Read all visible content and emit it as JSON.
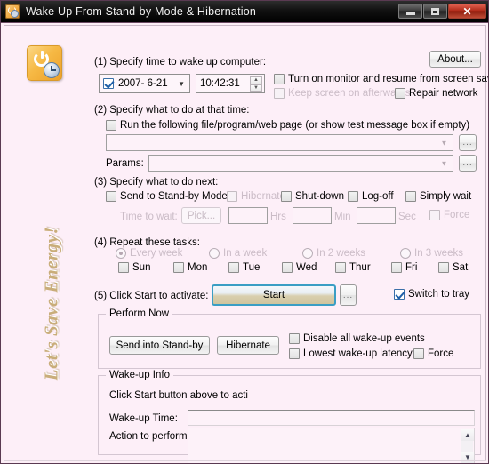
{
  "window": {
    "title": "Wake Up From Stand-by Mode & Hibernation",
    "icon": "power-clock-icon",
    "minimize_label": "Minimize",
    "maximize_label": "Maximize",
    "close_label": "✕"
  },
  "sidebar": {
    "slogan": "Let's Save Energy!",
    "app_icon": "power-clock-icon"
  },
  "about_button": "About...",
  "step1": {
    "label": "(1) Specify time to wake up computer:",
    "date_enabled": true,
    "date_value": "2007-  6-21",
    "time_value": "10:42:31",
    "monitor_checkbox": {
      "label": "Turn on monitor and resume from screen saver",
      "checked": false,
      "enabled": true
    },
    "keep_screen_checkbox": {
      "label": "Keep screen on afterwards",
      "checked": false,
      "enabled": false
    },
    "repair_network_checkbox": {
      "label": "Repair network",
      "checked": false,
      "enabled": true
    }
  },
  "step2": {
    "label": "(2) Specify what to do at that time:",
    "run_checkbox": {
      "label": "Run the following file/program/web page (or show test message box if empty)",
      "checked": false,
      "enabled": true
    },
    "file_combo_value": "",
    "file_browse_label": "...",
    "params_label": "Params:",
    "params_combo_value": "",
    "params_browse_label": "..."
  },
  "step3": {
    "label": "(3) Specify what to do next:",
    "options": [
      {
        "label": "Send to Stand-by Mode",
        "checked": false,
        "enabled": true
      },
      {
        "label": "Hibernate",
        "checked": false,
        "enabled": false
      },
      {
        "label": "Shut-down",
        "checked": false,
        "enabled": true
      },
      {
        "label": "Log-off",
        "checked": false,
        "enabled": true
      },
      {
        "label": "Simply wait",
        "checked": false,
        "enabled": true
      }
    ],
    "time_to_wait_label": "Time to wait:",
    "pick_button": "Pick...",
    "hrs_value": "",
    "hrs_label": "Hrs",
    "min_value": "",
    "min_label": "Min",
    "sec_value": "",
    "sec_label": "Sec",
    "force_checkbox": {
      "label": "Force",
      "checked": false,
      "enabled": false
    }
  },
  "step4": {
    "label": "(4) Repeat these tasks:",
    "radios": [
      {
        "label": "Every week",
        "selected": true,
        "enabled": false
      },
      {
        "label": "In a week",
        "selected": false,
        "enabled": false
      },
      {
        "label": "In 2 weeks",
        "selected": false,
        "enabled": false
      },
      {
        "label": "In 3 weeks",
        "selected": false,
        "enabled": false
      }
    ],
    "days": [
      {
        "label": "Sun",
        "checked": false
      },
      {
        "label": "Mon",
        "checked": false
      },
      {
        "label": "Tue",
        "checked": false
      },
      {
        "label": "Wed",
        "checked": false
      },
      {
        "label": "Thur",
        "checked": false
      },
      {
        "label": "Fri",
        "checked": false
      },
      {
        "label": "Sat",
        "checked": false
      }
    ]
  },
  "step5": {
    "label": "(5) Click Start to activate:",
    "start_button": "Start",
    "more_button": "...",
    "switch_to_tray": {
      "label": "Switch to tray",
      "checked": true,
      "enabled": true
    }
  },
  "perform_now": {
    "title": "Perform Now",
    "standby_button": "Send into Stand-by",
    "hibernate_button": "Hibernate",
    "disable_events": {
      "label": "Disable all wake-up events",
      "checked": false
    },
    "lowest_latency": {
      "label": "Lowest wake-up latency",
      "checked": false
    },
    "force": {
      "label": "Force",
      "checked": false
    }
  },
  "wakeup_info": {
    "title": "Wake-up Info",
    "hint": "Click Start button above to acti",
    "time_label": "Wake-up Time:",
    "time_value": "",
    "action_label": "Action to perform:",
    "action_value": "",
    "scroll_up": "▲",
    "scroll_down": "▼"
  },
  "colors": {
    "background": "#fdeff8",
    "accent_blue": "#3a9ec4",
    "slogan": "#c9ad7a",
    "disabled_text": "#cbbcc7"
  }
}
